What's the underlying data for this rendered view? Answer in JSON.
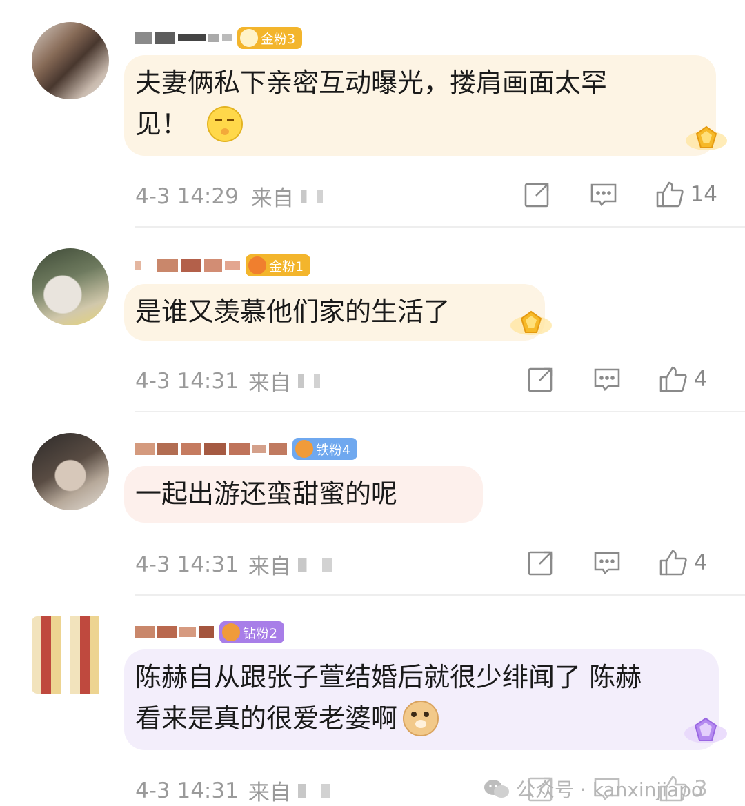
{
  "comments": [
    {
      "badge": "金粉3",
      "text": "夫妻俩私下亲密互动曝光，搂肩画面太罕见！",
      "line1": "夫妻俩私下亲密互动曝光，搂肩画面太罕",
      "line2": "见！",
      "emoji": "shush-emoji",
      "time": "4-3 14:29",
      "from": "来自",
      "likes": "14",
      "badge_color": "#f3b52c",
      "bubble_color": "#fdf4e4"
    },
    {
      "badge": "金粉1",
      "text": "是谁又羡慕他们家的生活了",
      "time": "4-3 14:31",
      "from": "来自",
      "likes": "4",
      "badge_color": "#f3b52c",
      "bubble_color": "#fdf4e4"
    },
    {
      "badge": "铁粉4",
      "text": "一起出游还蛮甜蜜的呢",
      "time": "4-3 14:31",
      "from": "来自",
      "likes": "4",
      "badge_color": "#6fa8ef",
      "bubble_color": "#fdf0ec"
    },
    {
      "badge": "钻粉2",
      "text": "陈赫自从跟张子萱结婚后就很少绯闻了 陈赫看来是真的很爱老婆啊",
      "line1": "陈赫自从跟张子萱结婚后就很少绯闻了 陈赫",
      "line2": "看来是真的很爱老婆啊",
      "emoji": "doge-emoji",
      "time": "4-3 14:31",
      "from": "来自",
      "likes": "3",
      "badge_color": "#a87ee8",
      "bubble_color": "#f3eefb"
    }
  ],
  "icons": {
    "repost": "repost-icon",
    "comment": "comment-icon",
    "like": "thumbs-up-icon"
  },
  "watermark": {
    "icon": "wechat-icon",
    "text": "公众号 · kanxinjiapo"
  }
}
